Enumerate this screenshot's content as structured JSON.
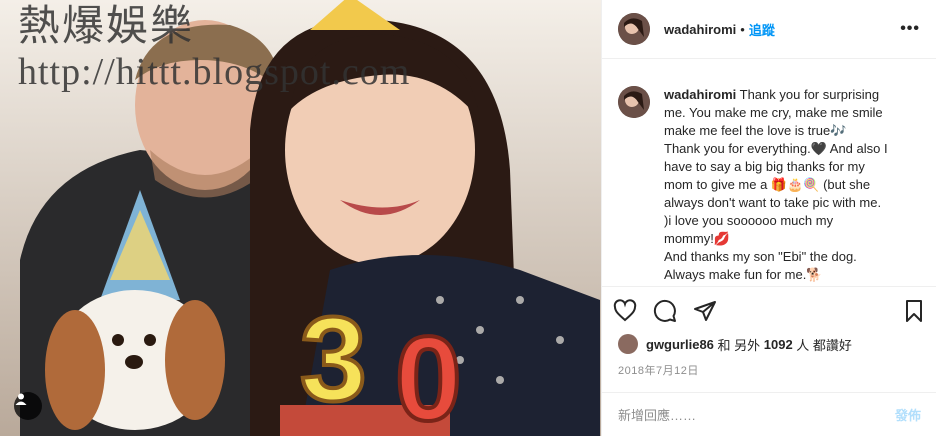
{
  "watermark": {
    "line1": "熱爆娛樂",
    "line2": "http://hittt.blogspot.com"
  },
  "header": {
    "username": "wadahiromi",
    "separator": "•",
    "follow_label": "追蹤",
    "more_label": "•••"
  },
  "caption": {
    "username": "wadahiromi",
    "lines": [
      "Thank you for surprising",
      "me. You make me cry, make me smile",
      "make me feel the love is true🎶",
      "Thank you for everything.🖤 And also I",
      "have to say a big big thanks for my",
      "mom to give me a 🎁🎂🍭 (but she",
      "always don't want to take pic with me.",
      ")i love you soooooo much my",
      "mommy!💋",
      "And thanks my son \"Ebi\" the dog.",
      "Always make fun for me.🐕"
    ]
  },
  "likes": {
    "user": "gwgurlie86",
    "mid": " 和 另外 ",
    "count": "1092",
    "suffix": " 人 都讚好"
  },
  "date": "2018年7月12日",
  "comment": {
    "placeholder": "新增回應……",
    "post_label": "發佈"
  },
  "icons": {
    "like": "heart-icon",
    "comment": "comment-bubble-icon",
    "share": "paper-plane-icon",
    "save": "bookmark-icon",
    "tag": "user-tag-icon"
  },
  "photo": {
    "candle_text": "30"
  }
}
